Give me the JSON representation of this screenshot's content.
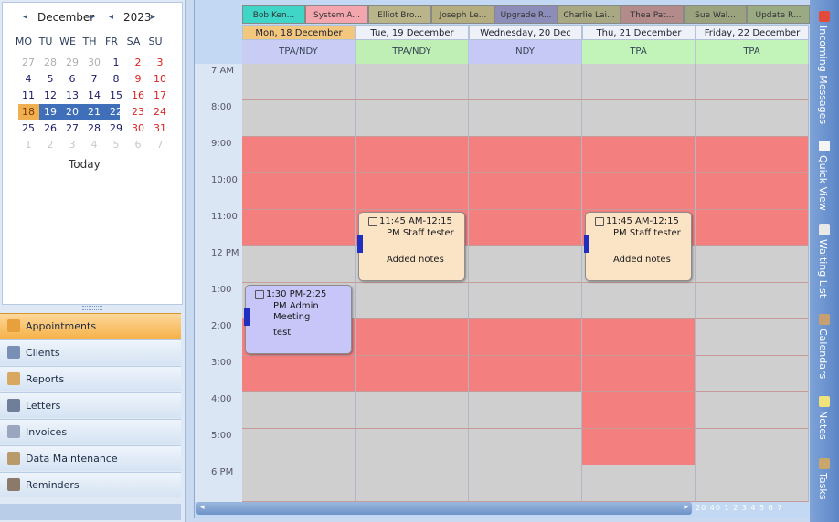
{
  "calendar": {
    "month": "December",
    "year": "2023",
    "prev": "◂",
    "next": "▸",
    "dow": [
      "MO",
      "TU",
      "WE",
      "TH",
      "FR",
      "SA",
      "SU"
    ],
    "weeks": [
      [
        "27",
        "28",
        "29",
        "30",
        "1",
        "2",
        "3"
      ],
      [
        "4",
        "5",
        "6",
        "7",
        "8",
        "9",
        "10"
      ],
      [
        "11",
        "12",
        "13",
        "14",
        "15",
        "16",
        "17"
      ],
      [
        "18",
        "19",
        "20",
        "21",
        "22",
        "23",
        "24"
      ],
      [
        "25",
        "26",
        "27",
        "28",
        "29",
        "30",
        "31"
      ],
      [
        "1",
        "2",
        "3",
        "4",
        "5",
        "6",
        "7"
      ]
    ],
    "today_label": "Today"
  },
  "nav": {
    "items": [
      "Appointments",
      "Clients",
      "Reports",
      "Letters",
      "Invoices",
      "Data Maintenance",
      "Reminders"
    ]
  },
  "scheduler": {
    "resources": [
      "Bob Ken...",
      "System A...",
      "Elliot Bro...",
      "Joseph Le...",
      "Upgrade R...",
      "Charlie Lai...",
      "Thea Pat...",
      "Sue Wal...",
      "Update R..."
    ],
    "resource_colors": [
      "#3fd6c8",
      "#f3a6ae",
      "#b9b48a",
      "#b3ad80",
      "#8c8db8",
      "#a8a882",
      "#b48b8b",
      "#9aa27e",
      "#9aaa82"
    ],
    "days": [
      "Mon, 18 December",
      "Tue, 19 December",
      "Wednesday, 20 Dec",
      "Thu, 21 December",
      "Friday, 22 December"
    ],
    "shifts": [
      "TPA/NDY",
      "TPA/NDY",
      "NDY",
      "TPA",
      "TPA"
    ],
    "shift_colors": [
      "#c9cdf5",
      "#bfefb5",
      "#c6c8f6",
      "#c2f3b8",
      "#c2f3b8"
    ],
    "times": [
      "7 AM",
      "8:00",
      "9:00",
      "10:00",
      "11:00",
      "12 PM",
      "1:00",
      "2:00",
      "3:00",
      "4:00",
      "5:00",
      "6 PM"
    ],
    "busy": [
      [
        0,
        0,
        1,
        1,
        1,
        0,
        0,
        1,
        1,
        0,
        0,
        0
      ],
      [
        0,
        0,
        1,
        1,
        1,
        0,
        0,
        1,
        1,
        0,
        0,
        0
      ],
      [
        0,
        0,
        1,
        1,
        1,
        0,
        0,
        1,
        1,
        0,
        0,
        0
      ],
      [
        0,
        0,
        1,
        1,
        1,
        0,
        0,
        1,
        1,
        1,
        1,
        0
      ],
      [
        0,
        0,
        1,
        1,
        1,
        0,
        0,
        0,
        0,
        0,
        0,
        0
      ]
    ],
    "appointments": [
      {
        "day": 1,
        "start": 4,
        "end": 6,
        "time": "11:45 AM-12:15",
        "subject": "PM Staff tester",
        "notes": "Added notes",
        "color": "#fbe3c6"
      },
      {
        "day": 3,
        "start": 4,
        "end": 6,
        "time": "11:45 AM-12:15",
        "subject": "PM Staff tester",
        "notes": "Added notes",
        "color": "#fbe3c6"
      },
      {
        "day": 0,
        "start": 6,
        "end": 8,
        "time": "1:30 PM-2:25",
        "subject": "PM Admin Meeting",
        "notes": "test",
        "color": "#c8c6f8"
      }
    ],
    "zoom_text": "20 40 1 2 3 4 5 6 7"
  },
  "right_tabs": [
    "Incoming Messages",
    "Quick View",
    "Waiting List",
    "Calendars",
    "Notes",
    "Tasks"
  ]
}
